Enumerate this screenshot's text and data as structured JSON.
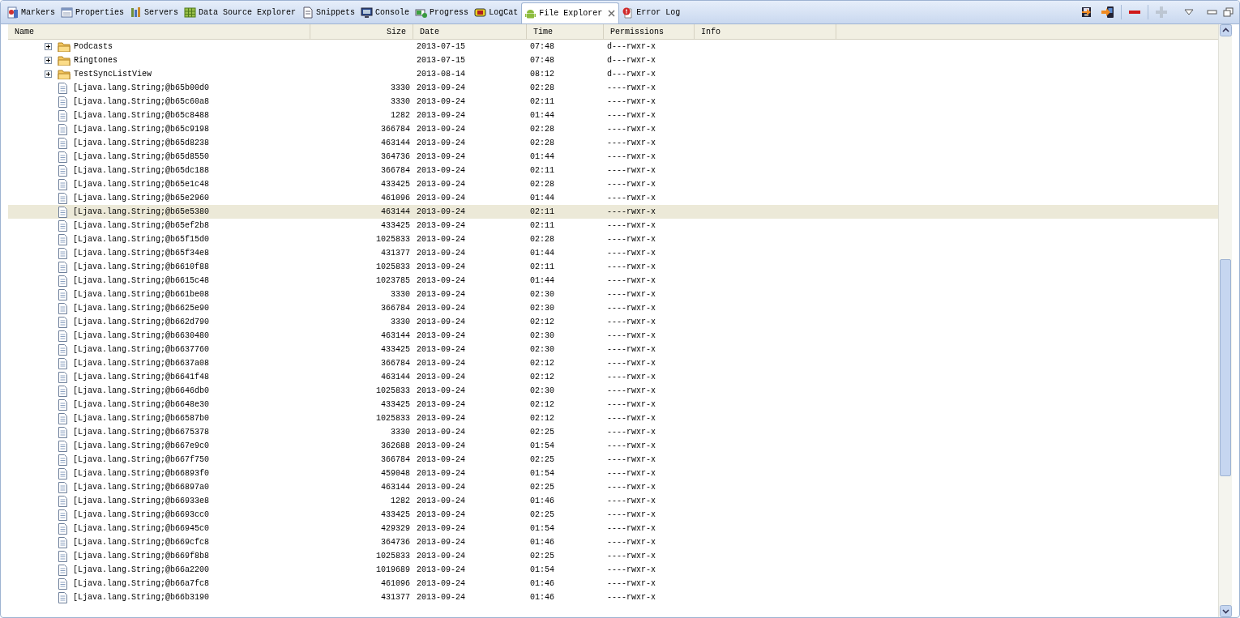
{
  "tabs": [
    {
      "label": "Markers",
      "kind": "markers",
      "selected": false
    },
    {
      "label": "Properties",
      "kind": "properties",
      "selected": false
    },
    {
      "label": "Servers",
      "kind": "servers",
      "selected": false
    },
    {
      "label": "Data Source Explorer",
      "kind": "datasource",
      "selected": false
    },
    {
      "label": "Snippets",
      "kind": "snippets",
      "selected": false
    },
    {
      "label": "Console",
      "kind": "console",
      "selected": false
    },
    {
      "label": "Progress",
      "kind": "progress",
      "selected": false
    },
    {
      "label": "LogCat",
      "kind": "logcat",
      "selected": false
    },
    {
      "label": "File Explorer",
      "kind": "android",
      "selected": true
    },
    {
      "label": "Error Log",
      "kind": "errorlog",
      "selected": false
    }
  ],
  "toolbar": [
    {
      "kind": "pull",
      "disabled": false
    },
    {
      "kind": "push",
      "disabled": false
    },
    {
      "kind": "delete",
      "disabled": false
    },
    {
      "kind": "add",
      "disabled": true
    }
  ],
  "table": {
    "columns": [
      "Name",
      "Size",
      "Date",
      "Time",
      "Permissions",
      "Info"
    ],
    "rows": [
      {
        "kind": "folder",
        "expanded": false,
        "selected": false,
        "name": "Podcasts",
        "size": "",
        "date": "2013-07-15",
        "time": "07:48",
        "permissions": "d---rwxr-x"
      },
      {
        "kind": "folder",
        "expanded": false,
        "selected": false,
        "name": "Ringtones",
        "size": "",
        "date": "2013-07-15",
        "time": "07:48",
        "permissions": "d---rwxr-x"
      },
      {
        "kind": "folder",
        "expanded": false,
        "selected": false,
        "name": "TestSyncListView",
        "size": "",
        "date": "2013-08-14",
        "time": "08:12",
        "permissions": "d---rwxr-x"
      },
      {
        "kind": "file",
        "selected": false,
        "name": "[Ljava.lang.String;@b65b00d0",
        "size": "3330",
        "date": "2013-09-24",
        "time": "02:28",
        "permissions": "----rwxr-x"
      },
      {
        "kind": "file",
        "selected": false,
        "name": "[Ljava.lang.String;@b65c60a8",
        "size": "3330",
        "date": "2013-09-24",
        "time": "02:11",
        "permissions": "----rwxr-x"
      },
      {
        "kind": "file",
        "selected": false,
        "name": "[Ljava.lang.String;@b65c8488",
        "size": "1282",
        "date": "2013-09-24",
        "time": "01:44",
        "permissions": "----rwxr-x"
      },
      {
        "kind": "file",
        "selected": false,
        "name": "[Ljava.lang.String;@b65c9198",
        "size": "366784",
        "date": "2013-09-24",
        "time": "02:28",
        "permissions": "----rwxr-x"
      },
      {
        "kind": "file",
        "selected": false,
        "name": "[Ljava.lang.String;@b65d8238",
        "size": "463144",
        "date": "2013-09-24",
        "time": "02:28",
        "permissions": "----rwxr-x"
      },
      {
        "kind": "file",
        "selected": false,
        "name": "[Ljava.lang.String;@b65d8550",
        "size": "364736",
        "date": "2013-09-24",
        "time": "01:44",
        "permissions": "----rwxr-x"
      },
      {
        "kind": "file",
        "selected": false,
        "name": "[Ljava.lang.String;@b65dc188",
        "size": "366784",
        "date": "2013-09-24",
        "time": "02:11",
        "permissions": "----rwxr-x"
      },
      {
        "kind": "file",
        "selected": false,
        "name": "[Ljava.lang.String;@b65e1c48",
        "size": "433425",
        "date": "2013-09-24",
        "time": "02:28",
        "permissions": "----rwxr-x"
      },
      {
        "kind": "file",
        "selected": false,
        "name": "[Ljava.lang.String;@b65e2960",
        "size": "461096",
        "date": "2013-09-24",
        "time": "01:44",
        "permissions": "----rwxr-x"
      },
      {
        "kind": "file",
        "selected": true,
        "name": "[Ljava.lang.String;@b65e5380",
        "size": "463144",
        "date": "2013-09-24",
        "time": "02:11",
        "permissions": "----rwxr-x"
      },
      {
        "kind": "file",
        "selected": false,
        "name": "[Ljava.lang.String;@b65ef2b8",
        "size": "433425",
        "date": "2013-09-24",
        "time": "02:11",
        "permissions": "----rwxr-x"
      },
      {
        "kind": "file",
        "selected": false,
        "name": "[Ljava.lang.String;@b65f15d0",
        "size": "1025833",
        "date": "2013-09-24",
        "time": "02:28",
        "permissions": "----rwxr-x"
      },
      {
        "kind": "file",
        "selected": false,
        "name": "[Ljava.lang.String;@b65f34e8",
        "size": "431377",
        "date": "2013-09-24",
        "time": "01:44",
        "permissions": "----rwxr-x"
      },
      {
        "kind": "file",
        "selected": false,
        "name": "[Ljava.lang.String;@b6610f88",
        "size": "1025833",
        "date": "2013-09-24",
        "time": "02:11",
        "permissions": "----rwxr-x"
      },
      {
        "kind": "file",
        "selected": false,
        "name": "[Ljava.lang.String;@b6615c48",
        "size": "1023785",
        "date": "2013-09-24",
        "time": "01:44",
        "permissions": "----rwxr-x"
      },
      {
        "kind": "file",
        "selected": false,
        "name": "[Ljava.lang.String;@b661be08",
        "size": "3330",
        "date": "2013-09-24",
        "time": "02:30",
        "permissions": "----rwxr-x"
      },
      {
        "kind": "file",
        "selected": false,
        "name": "[Ljava.lang.String;@b6625e90",
        "size": "366784",
        "date": "2013-09-24",
        "time": "02:30",
        "permissions": "----rwxr-x"
      },
      {
        "kind": "file",
        "selected": false,
        "name": "[Ljava.lang.String;@b662d790",
        "size": "3330",
        "date": "2013-09-24",
        "time": "02:12",
        "permissions": "----rwxr-x"
      },
      {
        "kind": "file",
        "selected": false,
        "name": "[Ljava.lang.String;@b6630480",
        "size": "463144",
        "date": "2013-09-24",
        "time": "02:30",
        "permissions": "----rwxr-x"
      },
      {
        "kind": "file",
        "selected": false,
        "name": "[Ljava.lang.String;@b6637760",
        "size": "433425",
        "date": "2013-09-24",
        "time": "02:30",
        "permissions": "----rwxr-x"
      },
      {
        "kind": "file",
        "selected": false,
        "name": "[Ljava.lang.String;@b6637a08",
        "size": "366784",
        "date": "2013-09-24",
        "time": "02:12",
        "permissions": "----rwxr-x"
      },
      {
        "kind": "file",
        "selected": false,
        "name": "[Ljava.lang.String;@b6641f48",
        "size": "463144",
        "date": "2013-09-24",
        "time": "02:12",
        "permissions": "----rwxr-x"
      },
      {
        "kind": "file",
        "selected": false,
        "name": "[Ljava.lang.String;@b6646db0",
        "size": "1025833",
        "date": "2013-09-24",
        "time": "02:30",
        "permissions": "----rwxr-x"
      },
      {
        "kind": "file",
        "selected": false,
        "name": "[Ljava.lang.String;@b6648e30",
        "size": "433425",
        "date": "2013-09-24",
        "time": "02:12",
        "permissions": "----rwxr-x"
      },
      {
        "kind": "file",
        "selected": false,
        "name": "[Ljava.lang.String;@b66587b0",
        "size": "1025833",
        "date": "2013-09-24",
        "time": "02:12",
        "permissions": "----rwxr-x"
      },
      {
        "kind": "file",
        "selected": false,
        "name": "[Ljava.lang.String;@b6675378",
        "size": "3330",
        "date": "2013-09-24",
        "time": "02:25",
        "permissions": "----rwxr-x"
      },
      {
        "kind": "file",
        "selected": false,
        "name": "[Ljava.lang.String;@b667e9c0",
        "size": "362688",
        "date": "2013-09-24",
        "time": "01:54",
        "permissions": "----rwxr-x"
      },
      {
        "kind": "file",
        "selected": false,
        "name": "[Ljava.lang.String;@b667f750",
        "size": "366784",
        "date": "2013-09-24",
        "time": "02:25",
        "permissions": "----rwxr-x"
      },
      {
        "kind": "file",
        "selected": false,
        "name": "[Ljava.lang.String;@b66893f0",
        "size": "459048",
        "date": "2013-09-24",
        "time": "01:54",
        "permissions": "----rwxr-x"
      },
      {
        "kind": "file",
        "selected": false,
        "name": "[Ljava.lang.String;@b66897a0",
        "size": "463144",
        "date": "2013-09-24",
        "time": "02:25",
        "permissions": "----rwxr-x"
      },
      {
        "kind": "file",
        "selected": false,
        "name": "[Ljava.lang.String;@b66933e8",
        "size": "1282",
        "date": "2013-09-24",
        "time": "01:46",
        "permissions": "----rwxr-x"
      },
      {
        "kind": "file",
        "selected": false,
        "name": "[Ljava.lang.String;@b6693cc0",
        "size": "433425",
        "date": "2013-09-24",
        "time": "02:25",
        "permissions": "----rwxr-x"
      },
      {
        "kind": "file",
        "selected": false,
        "name": "[Ljava.lang.String;@b66945c0",
        "size": "429329",
        "date": "2013-09-24",
        "time": "01:54",
        "permissions": "----rwxr-x"
      },
      {
        "kind": "file",
        "selected": false,
        "name": "[Ljava.lang.String;@b669cfc8",
        "size": "364736",
        "date": "2013-09-24",
        "time": "01:46",
        "permissions": "----rwxr-x"
      },
      {
        "kind": "file",
        "selected": false,
        "name": "[Ljava.lang.String;@b669f8b8",
        "size": "1025833",
        "date": "2013-09-24",
        "time": "02:25",
        "permissions": "----rwxr-x"
      },
      {
        "kind": "file",
        "selected": false,
        "name": "[Ljava.lang.String;@b66a2200",
        "size": "1019689",
        "date": "2013-09-24",
        "time": "01:54",
        "permissions": "----rwxr-x"
      },
      {
        "kind": "file",
        "selected": false,
        "name": "[Ljava.lang.String;@b66a7fc8",
        "size": "461096",
        "date": "2013-09-24",
        "time": "01:46",
        "permissions": "----rwxr-x"
      },
      {
        "kind": "file",
        "selected": false,
        "name": "[Ljava.lang.String;@b66b3190",
        "size": "431377",
        "date": "2013-09-24",
        "time": "01:46",
        "permissions": "----rwxr-x"
      }
    ]
  }
}
